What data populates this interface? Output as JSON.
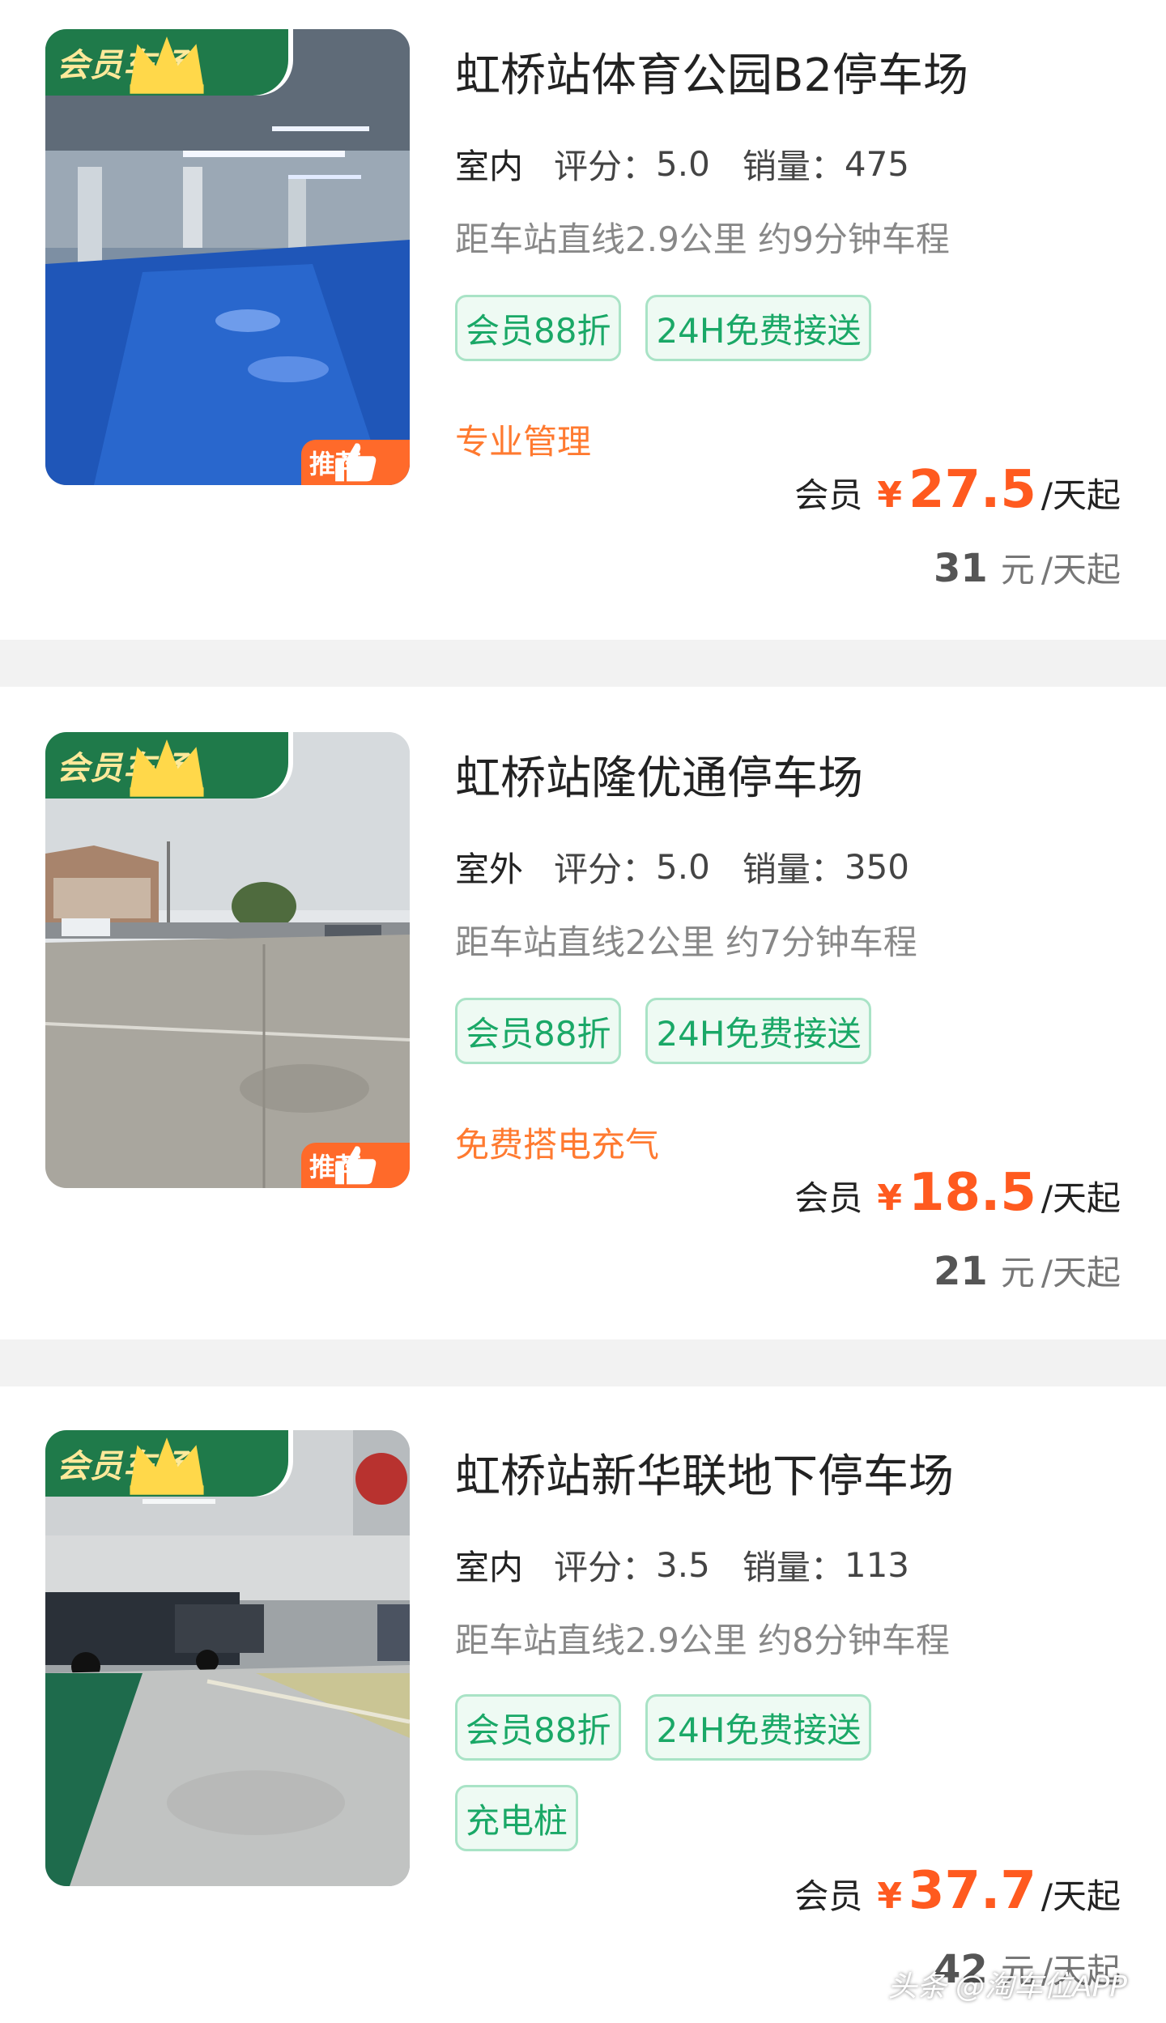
{
  "member_tag_label": "会员车场",
  "recommend_label": "推荐",
  "watermark": "头条 @淘车位APP",
  "colors": {
    "accent_green": "#1aa867",
    "price_orange": "#ff5a1f",
    "feature_orange": "#ff7a30",
    "member_badge_bg": "#1f7a4a"
  },
  "listings": [
    {
      "title": "虹桥站体育公园B2停车场",
      "kind": "室内",
      "rating_label": "评分：",
      "rating": "5.0",
      "sales_label": "销量：",
      "sales": "475",
      "distance": "距车站直线2.9公里 约9分钟车程",
      "tags": [
        "会员88折",
        "24H免费接送"
      ],
      "feature": "专业管理",
      "recommended": true,
      "member_label": "会员",
      "currency": "¥",
      "member_price": "27.5",
      "price_unit": "/天起",
      "original_price": "31",
      "original_currency": "元",
      "original_unit": "/天起",
      "photo": "indoor-garage-blue-floor"
    },
    {
      "title": "虹桥站隆优通停车场",
      "kind": "室外",
      "rating_label": "评分：",
      "rating": "5.0",
      "sales_label": "销量：",
      "sales": "350",
      "distance": "距车站直线2公里 约7分钟车程",
      "tags": [
        "会员88折",
        "24H免费接送"
      ],
      "feature": "免费搭电充气",
      "recommended": true,
      "member_label": "会员",
      "currency": "¥",
      "member_price": "18.5",
      "price_unit": "/天起",
      "original_price": "21",
      "original_currency": "元",
      "original_unit": "/天起",
      "photo": "outdoor-concrete-lot"
    },
    {
      "title": "虹桥站新华联地下停车场",
      "kind": "室内",
      "rating_label": "评分：",
      "rating": "3.5",
      "sales_label": "销量：",
      "sales": "113",
      "distance": "距车站直线2.9公里 约8分钟车程",
      "tags": [
        "会员88折",
        "24H免费接送",
        "充电桩"
      ],
      "feature": "",
      "recommended": false,
      "member_label": "会员",
      "currency": "¥",
      "member_price": "37.7",
      "price_unit": "/天起",
      "original_price": "42",
      "original_currency": "元",
      "original_unit": "/天起",
      "photo": "underground-garage-green-floor"
    }
  ]
}
